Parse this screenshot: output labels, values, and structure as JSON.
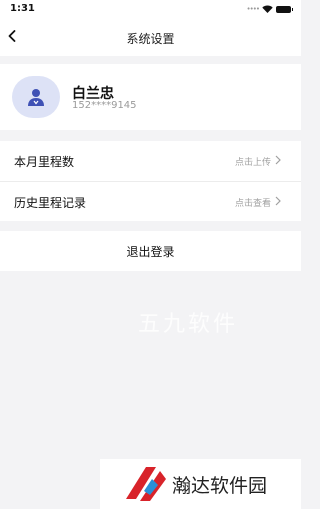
{
  "status_bar": {
    "time": "1:31",
    "signal_icon": "signal-dots-icon",
    "wifi_icon": "wifi-icon",
    "battery_icon": "battery-icon"
  },
  "nav": {
    "back_icon": "chevron-left-icon",
    "title": "系统设置"
  },
  "profile": {
    "avatar_icon": "user-icon",
    "name": "白兰忠",
    "phone": "152****9145"
  },
  "menu": {
    "items": [
      {
        "label": "本月里程数",
        "hint": "点击上传"
      },
      {
        "label": "历史里程记录",
        "hint": "点击查看"
      }
    ]
  },
  "logout": {
    "label": "退出登录"
  },
  "watermark": {
    "text": "五九软件"
  },
  "site_badge": {
    "name": "瀚达软件园"
  },
  "colors": {
    "background": "#f3f3f5",
    "card": "#ffffff",
    "avatar_bg": "#dde2f6",
    "avatar_icon": "#3f51b5",
    "hint_text": "#a0a0a0",
    "logo_red": "#d8232a",
    "logo_blue": "#2a8fd6"
  }
}
